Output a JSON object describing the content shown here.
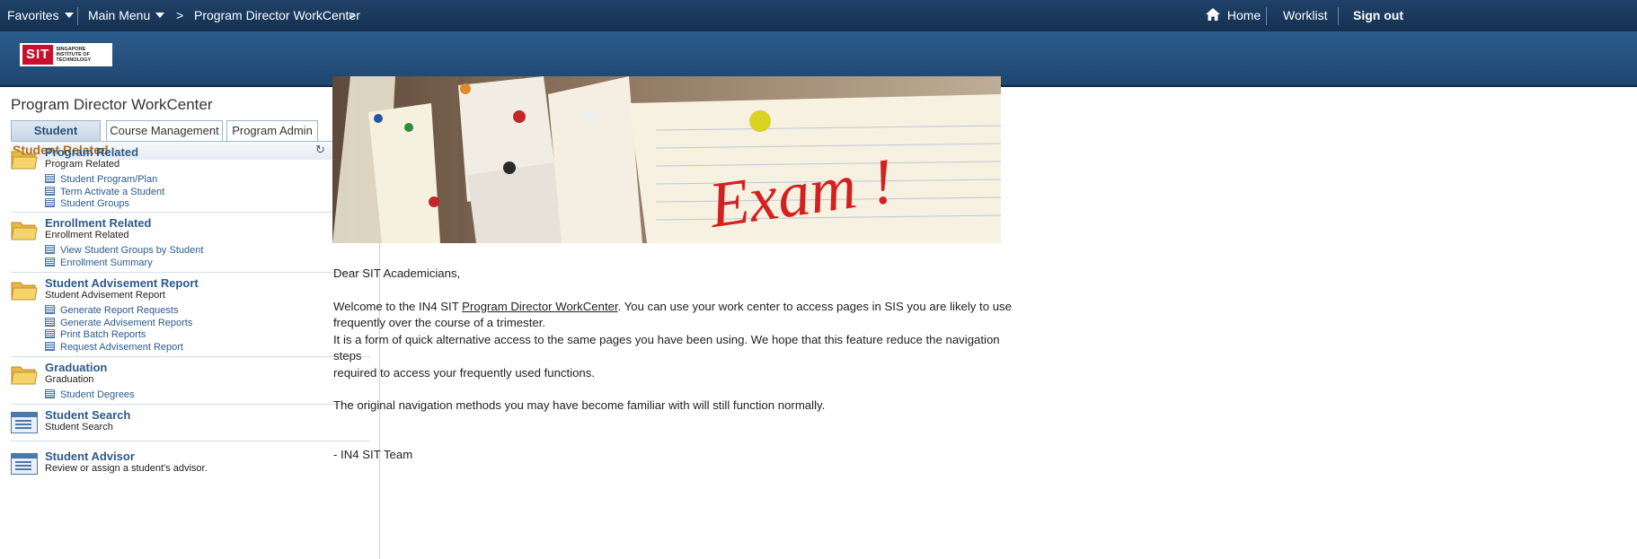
{
  "topbar": {
    "favorites": "Favorites",
    "main_menu": "Main Menu",
    "breadcrumb_sep": ">",
    "breadcrumb": "Program Director WorkCenter",
    "home": "Home",
    "worklist": "Worklist",
    "signout": "Sign out"
  },
  "logo": {
    "mark": "SIT",
    "text": "SINGAPORE INSTITUTE OF TECHNOLOGY"
  },
  "sidebar": {
    "title": "Program Director WorkCenter",
    "tabs": [
      "Student Related",
      "Course Management",
      "Program Admin"
    ],
    "pagelet_title": "Student Related",
    "groups": [
      {
        "title": "Program Related",
        "subtitle": "Program Related",
        "links": [
          "Student Program/Plan",
          "Term Activate a Student",
          "Student Groups"
        ]
      },
      {
        "title": "Enrollment Related",
        "subtitle": "Enrollment Related",
        "links": [
          "View Student Groups by Student",
          "Enrollment Summary"
        ]
      },
      {
        "title": "Student Advisement Report",
        "subtitle": "Student Advisement Report",
        "links": [
          "Generate Report Requests",
          "Generate Advisement Reports",
          "Print Batch Reports",
          "Request Advisement Report"
        ]
      },
      {
        "title": "Graduation",
        "subtitle": "Graduation",
        "links": [
          "Student Degrees"
        ]
      }
    ],
    "pages": [
      {
        "title": "Student Search",
        "subtitle": "Student Search"
      },
      {
        "title": "Student Advisor",
        "subtitle": "Review or assign a student's advisor."
      }
    ]
  },
  "banner": {
    "text": "Exam !"
  },
  "message": {
    "greeting": "Dear SIT Academicians,",
    "p1_pre": "Welcome to the IN4 SIT ",
    "p1_link": "Program Director WorkCenter",
    "p1_post": ". You can use your work center to access pages in SIS you are likely to use",
    "p1_line2": "frequently over the course of a trimester.",
    "p2_line1": "It is a form of quick alternative access to the same pages you have been using. We hope that this feature reduce the navigation steps",
    "p2_line2": "required to access your frequently used functions.",
    "p3": "The original navigation methods you may have become familiar with will still function normally.",
    "signoff": "- IN4 SIT Team"
  },
  "colors": {
    "topbar": "#14304f",
    "header": "#2c5d8c",
    "link": "#2c5a8c",
    "pagelet_title": "#b36e16"
  }
}
